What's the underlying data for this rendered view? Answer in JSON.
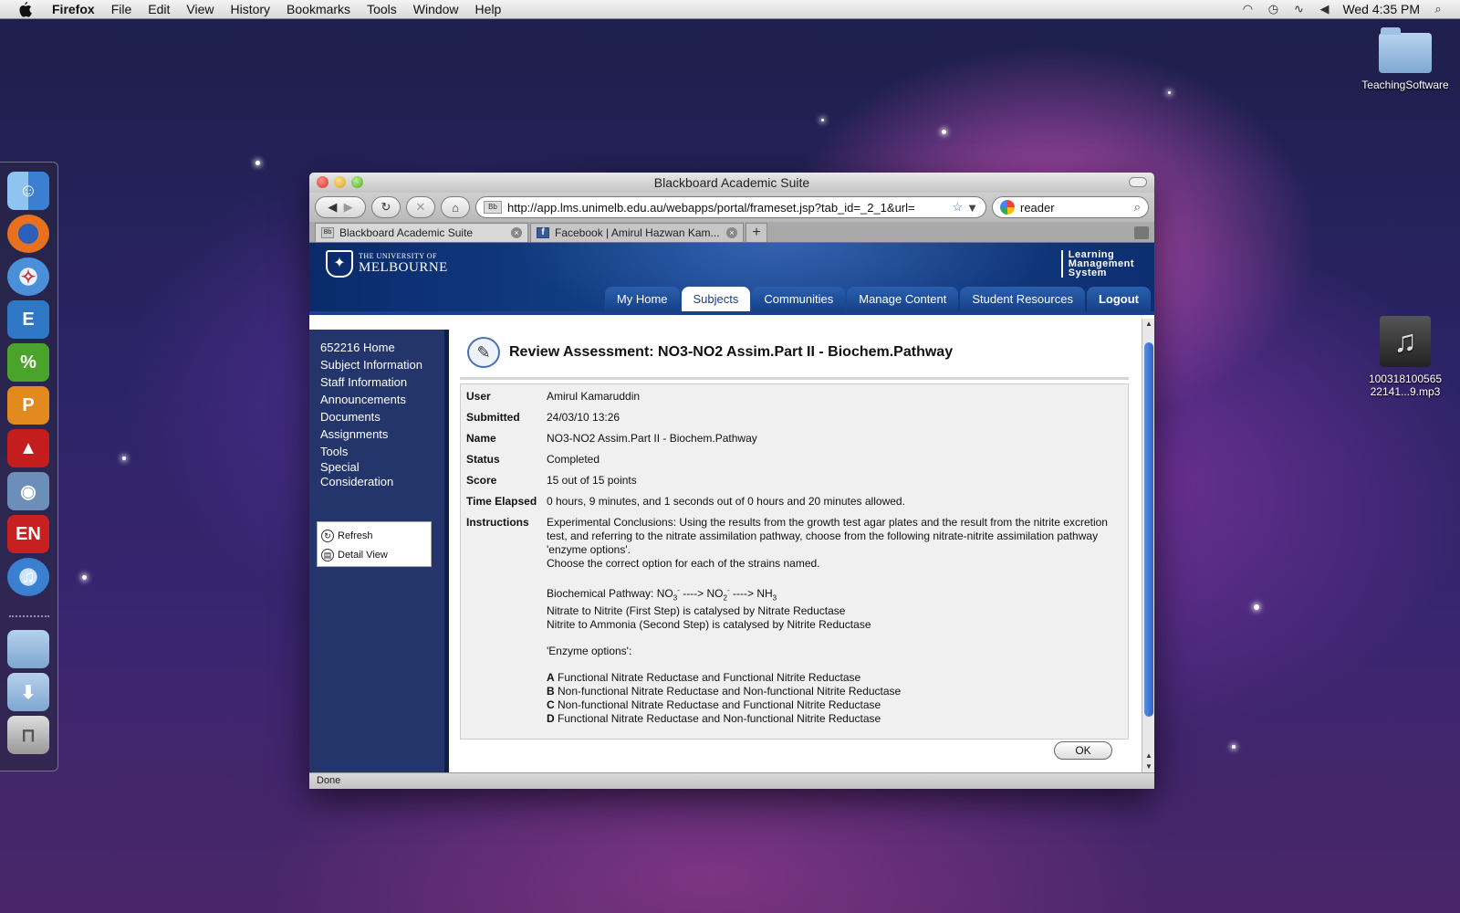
{
  "menubar": {
    "app_name": "Firefox",
    "items": [
      "File",
      "Edit",
      "View",
      "History",
      "Bookmarks",
      "Tools",
      "Window",
      "Help"
    ],
    "clock": "Wed 4:35 PM"
  },
  "desktop": {
    "folder_label": "TeachingSoftware",
    "music_label_line1": "100318100565",
    "music_label_line2": "22141...9.mp3"
  },
  "window": {
    "title": "Blackboard Academic Suite",
    "url": "http://app.lms.unimelb.edu.au/webapps/portal/frameset.jsp?tab_id=_2_1&url=",
    "search_value": "reader",
    "tabs": [
      {
        "title": "Blackboard Academic Suite",
        "favicon": "Bb"
      },
      {
        "title": "Facebook | Amirul Hazwan Kam...",
        "favicon": "f"
      }
    ],
    "new_tab_label": "+",
    "status": "Done"
  },
  "lms": {
    "university_small": "THE UNIVERSITY OF",
    "university_big": "MELBOURNE",
    "brand_lines": [
      "Learning",
      "Management",
      "System"
    ],
    "tabs": [
      {
        "label": "My Home"
      },
      {
        "label": "Subjects"
      },
      {
        "label": "Communities"
      },
      {
        "label": "Manage Content"
      },
      {
        "label": "Student Resources"
      },
      {
        "label": "Logout"
      }
    ],
    "leftnav": [
      "652216 Home",
      "Subject Information",
      "Staff Information",
      "Announcements",
      "Documents",
      "Assignments",
      "Tools",
      "Special Consideration"
    ],
    "toolbox": {
      "refresh": "Refresh",
      "detail_view": "Detail View"
    }
  },
  "assessment": {
    "title": "Review Assessment: NO3-NO2 Assim.Part II - Biochem.Pathway",
    "labels": {
      "user": "User",
      "submitted": "Submitted",
      "name": "Name",
      "status": "Status",
      "score": "Score",
      "time_elapsed": "Time Elapsed",
      "instructions": "Instructions"
    },
    "user": "Amirul Kamaruddin",
    "submitted": "24/03/10 13:26",
    "name": "NO3-NO2 Assim.Part II - Biochem.Pathway",
    "status": "Completed",
    "score": "15 out of 15 points",
    "time_elapsed": "0 hours, 9 minutes, and 1 seconds out of 0 hours and 20 minutes allowed.",
    "instructions": {
      "para1": "Experimental Conclusions: Using the results from the growth test agar plates and the result from the nitrite excretion test, and referring to the nitrate assimilation pathway, choose from the following nitrate-nitrite assimilation pathway 'enzyme options'.",
      "para2": "Choose the correct option for each of the strains named.",
      "pathway_prefix": "Biochemical Pathway: NO",
      "pathway_sub1": "3",
      "pathway_sup1": "-",
      "pathway_arrow1": " ----> NO",
      "pathway_sub2": "2",
      "pathway_sup2": "-",
      "pathway_arrow2": " ----> NH",
      "pathway_sub3": "3",
      "step1": "Nitrate to Nitrite (First Step) is catalysed by Nitrate Reductase",
      "step2": "Nitrite to Ammonia (Second Step) is catalysed by Nitrite Reductase",
      "options_heading": "'Enzyme options':",
      "options": [
        {
          "key": "A",
          "text": "Functional Nitrate Reductase and Functional Nitrite Reductase"
        },
        {
          "key": "B",
          "text": "Non-functional Nitrate Reductase and Non-functional Nitrite Reductase"
        },
        {
          "key": "C",
          "text": "Non-functional Nitrate Reductase and Functional Nitrite Reductase"
        },
        {
          "key": "D",
          "text": "Functional Nitrate Reductase and Non-functional Nitrite Reductase"
        }
      ]
    },
    "ok_label": "OK"
  }
}
